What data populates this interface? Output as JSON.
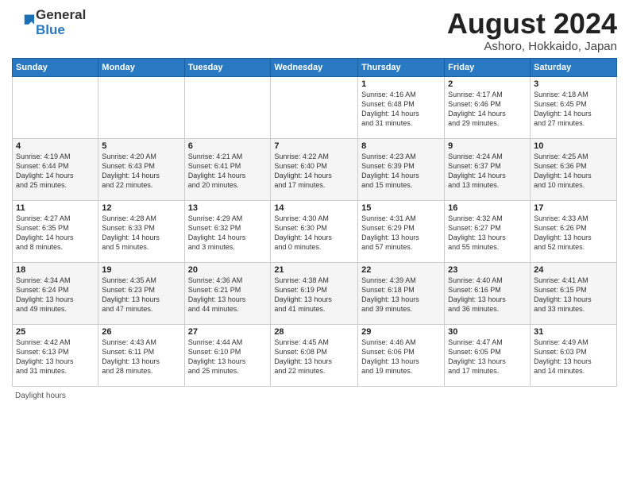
{
  "header": {
    "logo_line1": "General",
    "logo_line2": "Blue",
    "title": "August 2024",
    "subtitle": "Ashoro, Hokkaido, Japan"
  },
  "columns": [
    "Sunday",
    "Monday",
    "Tuesday",
    "Wednesday",
    "Thursday",
    "Friday",
    "Saturday"
  ],
  "footer": {
    "label": "Daylight hours"
  },
  "weeks": [
    [
      {
        "day": "",
        "info": ""
      },
      {
        "day": "",
        "info": ""
      },
      {
        "day": "",
        "info": ""
      },
      {
        "day": "",
        "info": ""
      },
      {
        "day": "1",
        "info": "Sunrise: 4:16 AM\nSunset: 6:48 PM\nDaylight: 14 hours\nand 31 minutes."
      },
      {
        "day": "2",
        "info": "Sunrise: 4:17 AM\nSunset: 6:46 PM\nDaylight: 14 hours\nand 29 minutes."
      },
      {
        "day": "3",
        "info": "Sunrise: 4:18 AM\nSunset: 6:45 PM\nDaylight: 14 hours\nand 27 minutes."
      }
    ],
    [
      {
        "day": "4",
        "info": "Sunrise: 4:19 AM\nSunset: 6:44 PM\nDaylight: 14 hours\nand 25 minutes."
      },
      {
        "day": "5",
        "info": "Sunrise: 4:20 AM\nSunset: 6:43 PM\nDaylight: 14 hours\nand 22 minutes."
      },
      {
        "day": "6",
        "info": "Sunrise: 4:21 AM\nSunset: 6:41 PM\nDaylight: 14 hours\nand 20 minutes."
      },
      {
        "day": "7",
        "info": "Sunrise: 4:22 AM\nSunset: 6:40 PM\nDaylight: 14 hours\nand 17 minutes."
      },
      {
        "day": "8",
        "info": "Sunrise: 4:23 AM\nSunset: 6:39 PM\nDaylight: 14 hours\nand 15 minutes."
      },
      {
        "day": "9",
        "info": "Sunrise: 4:24 AM\nSunset: 6:37 PM\nDaylight: 14 hours\nand 13 minutes."
      },
      {
        "day": "10",
        "info": "Sunrise: 4:25 AM\nSunset: 6:36 PM\nDaylight: 14 hours\nand 10 minutes."
      }
    ],
    [
      {
        "day": "11",
        "info": "Sunrise: 4:27 AM\nSunset: 6:35 PM\nDaylight: 14 hours\nand 8 minutes."
      },
      {
        "day": "12",
        "info": "Sunrise: 4:28 AM\nSunset: 6:33 PM\nDaylight: 14 hours\nand 5 minutes."
      },
      {
        "day": "13",
        "info": "Sunrise: 4:29 AM\nSunset: 6:32 PM\nDaylight: 14 hours\nand 3 minutes."
      },
      {
        "day": "14",
        "info": "Sunrise: 4:30 AM\nSunset: 6:30 PM\nDaylight: 14 hours\nand 0 minutes."
      },
      {
        "day": "15",
        "info": "Sunrise: 4:31 AM\nSunset: 6:29 PM\nDaylight: 13 hours\nand 57 minutes."
      },
      {
        "day": "16",
        "info": "Sunrise: 4:32 AM\nSunset: 6:27 PM\nDaylight: 13 hours\nand 55 minutes."
      },
      {
        "day": "17",
        "info": "Sunrise: 4:33 AM\nSunset: 6:26 PM\nDaylight: 13 hours\nand 52 minutes."
      }
    ],
    [
      {
        "day": "18",
        "info": "Sunrise: 4:34 AM\nSunset: 6:24 PM\nDaylight: 13 hours\nand 49 minutes."
      },
      {
        "day": "19",
        "info": "Sunrise: 4:35 AM\nSunset: 6:23 PM\nDaylight: 13 hours\nand 47 minutes."
      },
      {
        "day": "20",
        "info": "Sunrise: 4:36 AM\nSunset: 6:21 PM\nDaylight: 13 hours\nand 44 minutes."
      },
      {
        "day": "21",
        "info": "Sunrise: 4:38 AM\nSunset: 6:19 PM\nDaylight: 13 hours\nand 41 minutes."
      },
      {
        "day": "22",
        "info": "Sunrise: 4:39 AM\nSunset: 6:18 PM\nDaylight: 13 hours\nand 39 minutes."
      },
      {
        "day": "23",
        "info": "Sunrise: 4:40 AM\nSunset: 6:16 PM\nDaylight: 13 hours\nand 36 minutes."
      },
      {
        "day": "24",
        "info": "Sunrise: 4:41 AM\nSunset: 6:15 PM\nDaylight: 13 hours\nand 33 minutes."
      }
    ],
    [
      {
        "day": "25",
        "info": "Sunrise: 4:42 AM\nSunset: 6:13 PM\nDaylight: 13 hours\nand 31 minutes."
      },
      {
        "day": "26",
        "info": "Sunrise: 4:43 AM\nSunset: 6:11 PM\nDaylight: 13 hours\nand 28 minutes."
      },
      {
        "day": "27",
        "info": "Sunrise: 4:44 AM\nSunset: 6:10 PM\nDaylight: 13 hours\nand 25 minutes."
      },
      {
        "day": "28",
        "info": "Sunrise: 4:45 AM\nSunset: 6:08 PM\nDaylight: 13 hours\nand 22 minutes."
      },
      {
        "day": "29",
        "info": "Sunrise: 4:46 AM\nSunset: 6:06 PM\nDaylight: 13 hours\nand 19 minutes."
      },
      {
        "day": "30",
        "info": "Sunrise: 4:47 AM\nSunset: 6:05 PM\nDaylight: 13 hours\nand 17 minutes."
      },
      {
        "day": "31",
        "info": "Sunrise: 4:49 AM\nSunset: 6:03 PM\nDaylight: 13 hours\nand 14 minutes."
      }
    ]
  ]
}
